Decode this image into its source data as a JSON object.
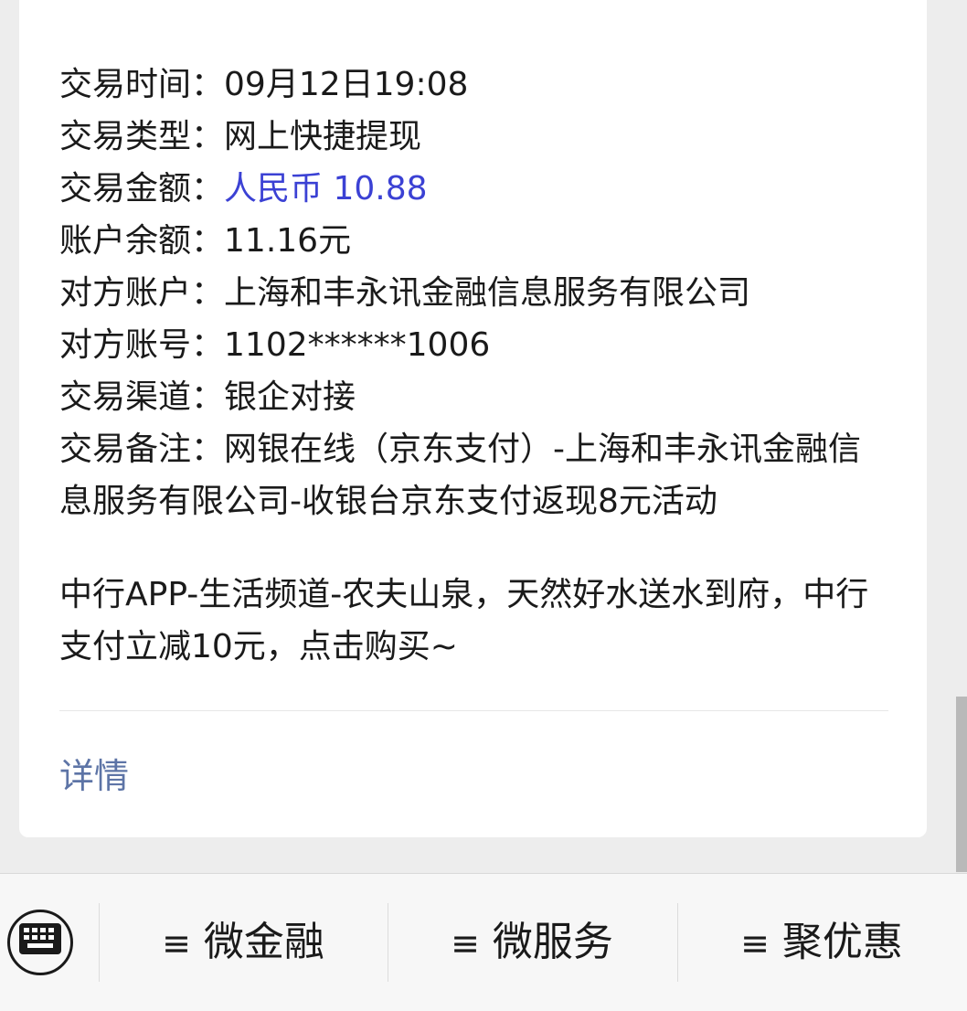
{
  "transaction": {
    "time_label": "交易时间：",
    "time_value": "09月12日19:08",
    "type_label": "交易类型：",
    "type_value": "网上快捷提现",
    "amount_label": "交易金额：",
    "amount_value": "人民币 10.88",
    "balance_label": "账户余额：",
    "balance_value": "11.16元",
    "counterparty_label": "对方账户：",
    "counterparty_value": "上海和丰永讯金融信息服务有限公司",
    "counterparty_no_label": "对方账号：",
    "counterparty_no_value": "1102******1006",
    "channel_label": "交易渠道：",
    "channel_value": "银企对接",
    "remark_label": "交易备注：",
    "remark_value": "网银在线（京东支付）-上海和丰永讯金融信息服务有限公司-收银台京东支付返现8元活动"
  },
  "promo_text": "中行APP-生活频道-农夫山泉，天然好水送水到府，中行支付立减10元，点击购买~",
  "detail_link": "详情",
  "bottom_menu": {
    "icon": "≡",
    "items": [
      {
        "label": "微金融"
      },
      {
        "label": "微服务"
      },
      {
        "label": "聚优惠"
      }
    ]
  },
  "colors": {
    "amount": "#3b41d4",
    "link": "#5d74a6"
  },
  "icons": {
    "keyboard": "keyboard-icon",
    "menu": "menu-lines-icon"
  }
}
